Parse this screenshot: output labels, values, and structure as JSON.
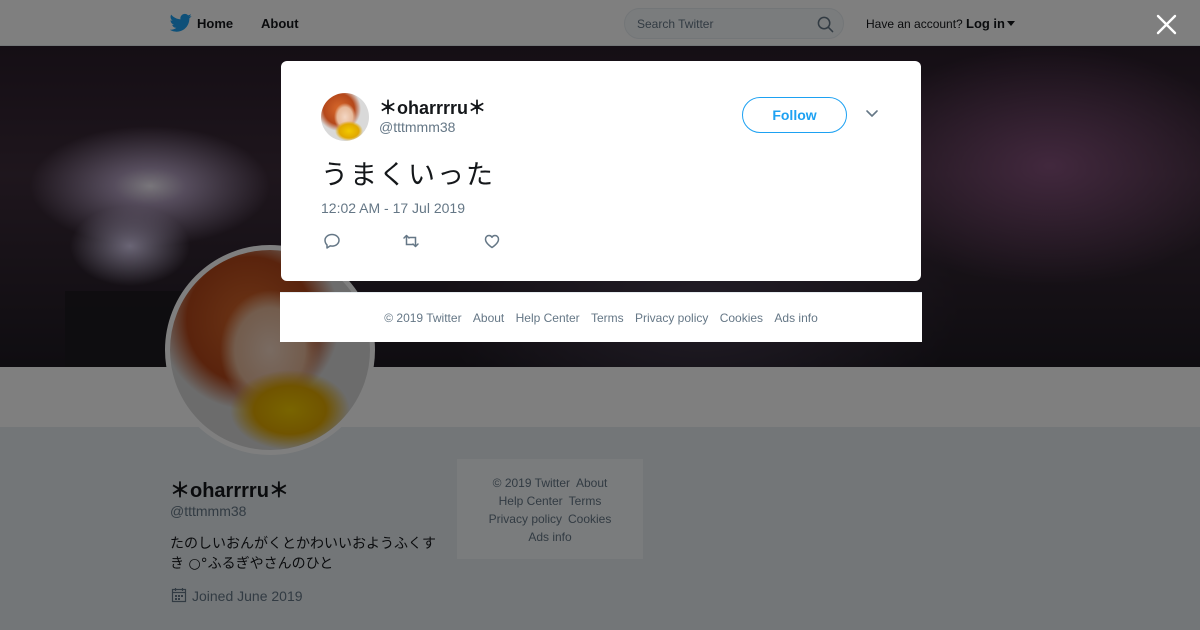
{
  "nav": {
    "home": "Home",
    "about": "About",
    "search_placeholder": "Search Twitter",
    "account_text": "Have an account?",
    "login": "Log in"
  },
  "profile": {
    "name": "＊oharrrru＊",
    "handle": "@tttmmm38",
    "bio": "たのしいおんがくとかわいいおようふくすき ○°ふるぎやさんのひと",
    "joined": "Joined June 2019"
  },
  "side_footer": {
    "copyright": "© 2019 Twitter",
    "about": "About",
    "help": "Help Center",
    "terms": "Terms",
    "privacy": "Privacy policy",
    "cookies": "Cookies",
    "ads": "Ads info"
  },
  "tweet": {
    "name": "＊oharrrru＊",
    "handle": "@tttmmm38",
    "follow": "Follow",
    "text": "うまくいった",
    "timestamp": "12:02 AM - 17 Jul 2019"
  },
  "modal_footer": {
    "copyright": "© 2019 Twitter",
    "about": "About",
    "help": "Help Center",
    "terms": "Terms",
    "privacy": "Privacy policy",
    "cookies": "Cookies",
    "ads": "Ads info"
  },
  "colors": {
    "accent": "#1da1f2",
    "text": "#14171a",
    "muted": "#657786"
  },
  "icons": [
    "twitter-bird-icon",
    "search-icon",
    "close-icon",
    "chevron-down-icon",
    "reply-icon",
    "retweet-icon",
    "like-icon",
    "calendar-icon"
  ]
}
